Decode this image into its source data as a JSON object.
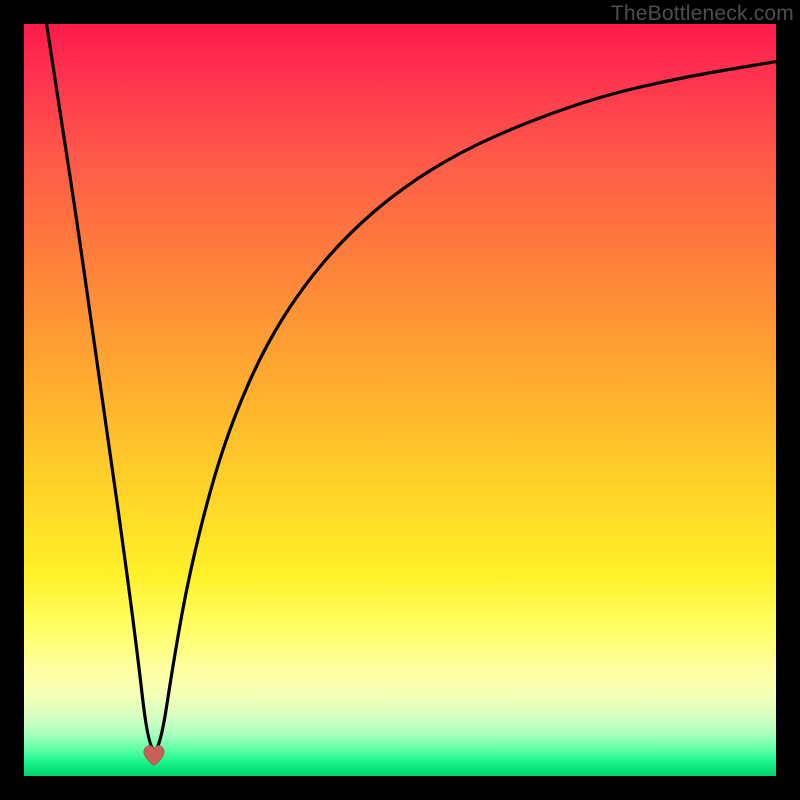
{
  "watermark": "TheBottleneck.com",
  "chart_data": {
    "type": "line",
    "title": "",
    "xlabel": "",
    "ylabel": "",
    "xlim": [
      0,
      100
    ],
    "ylim": [
      0,
      100
    ],
    "series": [
      {
        "name": "bottleneck-curve",
        "x": [
          3.0,
          5,
          7,
          9,
          11,
          13,
          15,
          16.5,
          18,
          20,
          22,
          25,
          28,
          32,
          37,
          43,
          50,
          58,
          67,
          77,
          88,
          100
        ],
        "values": [
          100,
          87,
          74,
          60,
          46,
          32,
          17,
          4,
          3,
          16,
          27,
          39,
          48,
          57,
          65,
          72,
          78,
          83,
          87,
          90.5,
          93,
          95
        ]
      }
    ],
    "marker": {
      "x": 17.3,
      "y": 2.2,
      "shape": "heart",
      "color": "#c7625a"
    },
    "background_gradient": {
      "stops": [
        {
          "pos": 0,
          "color": "#ff1a4a"
        },
        {
          "pos": 0.33,
          "color": "#ff8439"
        },
        {
          "pos": 0.62,
          "color": "#ffd427"
        },
        {
          "pos": 0.85,
          "color": "#ffff9a"
        },
        {
          "pos": 1.0,
          "color": "#07d46e"
        }
      ]
    }
  }
}
